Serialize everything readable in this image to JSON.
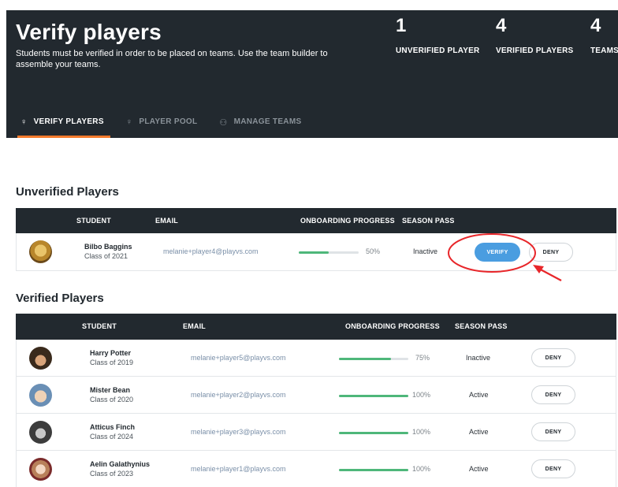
{
  "header": {
    "title": "Verify players",
    "subtitle": "Students must be verified in order to be placed on teams. Use the team builder to assemble your teams.",
    "stats": [
      {
        "value": "1",
        "label": "UNVERIFIED PLAYER"
      },
      {
        "value": "4",
        "label": "VERIFIED PLAYERS"
      },
      {
        "value": "4",
        "label": "TEAMS"
      }
    ],
    "tabs": [
      {
        "label": "VERIFY PLAYERS",
        "icon": "player-icon",
        "active": true
      },
      {
        "label": "PLAYER POOL",
        "icon": "player-icon",
        "active": false
      },
      {
        "label": "MANAGE TEAMS",
        "icon": "team-icon",
        "active": false
      }
    ]
  },
  "unverified": {
    "title": "Unverified Players",
    "columns": [
      "STUDENT",
      "EMAIL",
      "ONBOARDING PROGRESS",
      "SEASON PASS"
    ],
    "rows": [
      {
        "name": "Bilbo Baggins",
        "class": "Class of 2021",
        "email": "melanie+player4@playvs.com",
        "progress": 50,
        "progress_label": "50%",
        "season_pass": "Inactive",
        "verify_label": "VERIFY",
        "deny_label": "DENY"
      }
    ]
  },
  "verified": {
    "title": "Verified Players",
    "columns": [
      "STUDENT",
      "EMAIL",
      "ONBOARDING PROGRESS",
      "SEASON PASS"
    ],
    "rows": [
      {
        "name": "Harry Potter",
        "class": "Class of 2019",
        "email": "melanie+player5@playvs.com",
        "progress": 75,
        "progress_label": "75%",
        "season_pass": "Inactive",
        "deny_label": "DENY"
      },
      {
        "name": "Mister Bean",
        "class": "Class of 2020",
        "email": "melanie+player2@playvs.com",
        "progress": 100,
        "progress_label": "100%",
        "season_pass": "Active",
        "deny_label": "DENY"
      },
      {
        "name": "Atticus Finch",
        "class": "Class of 2024",
        "email": "melanie+player3@playvs.com",
        "progress": 100,
        "progress_label": "100%",
        "season_pass": "Active",
        "deny_label": "DENY"
      },
      {
        "name": "Aelin Galathynius",
        "class": "Class of 2023",
        "email": "melanie+player1@playvs.com",
        "progress": 100,
        "progress_label": "100%",
        "season_pass": "Active",
        "deny_label": "DENY"
      }
    ]
  },
  "colors": {
    "header_bg": "#22292f",
    "tab_accent": "#f47a2c",
    "progress_fill": "#4eb77a",
    "verify_button": "#4a9de0",
    "annotation": "#e8262a"
  }
}
